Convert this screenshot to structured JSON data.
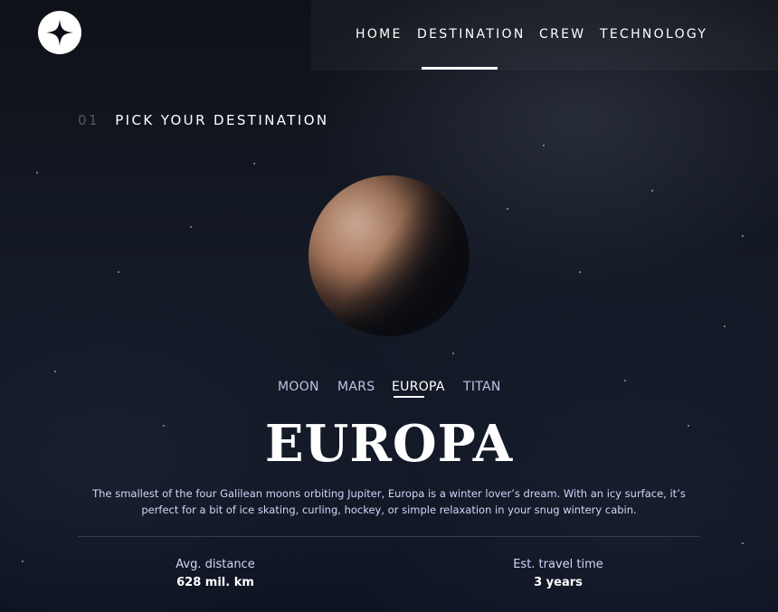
{
  "header": {
    "logo_icon": "star-logo-icon",
    "nav": [
      {
        "num": "",
        "label": "HOME"
      },
      {
        "num": "",
        "label": "DESTINATION"
      },
      {
        "num": "",
        "label": "CREW"
      },
      {
        "num": "",
        "label": "TECHNOLOGY"
      }
    ],
    "active_nav": "DESTINATION"
  },
  "page": {
    "number": "01",
    "title": "PICK YOUR DESTINATION"
  },
  "tabs": [
    "MOON",
    "MARS",
    "EUROPA",
    "TITAN"
  ],
  "active_tab": "EUROPA",
  "destination": {
    "name": "EUROPA",
    "description": "The smallest of the four Galilean moons orbiting Jupiter, Europa is a winter lover’s dream. With an icy surface, it’s perfect for a bit of ice skating, curling, hockey, or simple relaxation in your snug wintery cabin.",
    "distance_label": "Avg. distance",
    "distance_value": "628 mil. km",
    "travel_label": "Est. travel time",
    "travel_value": "3 years"
  },
  "colors": {
    "text_secondary": "#d0d6f9",
    "divider": "#383b4b"
  }
}
